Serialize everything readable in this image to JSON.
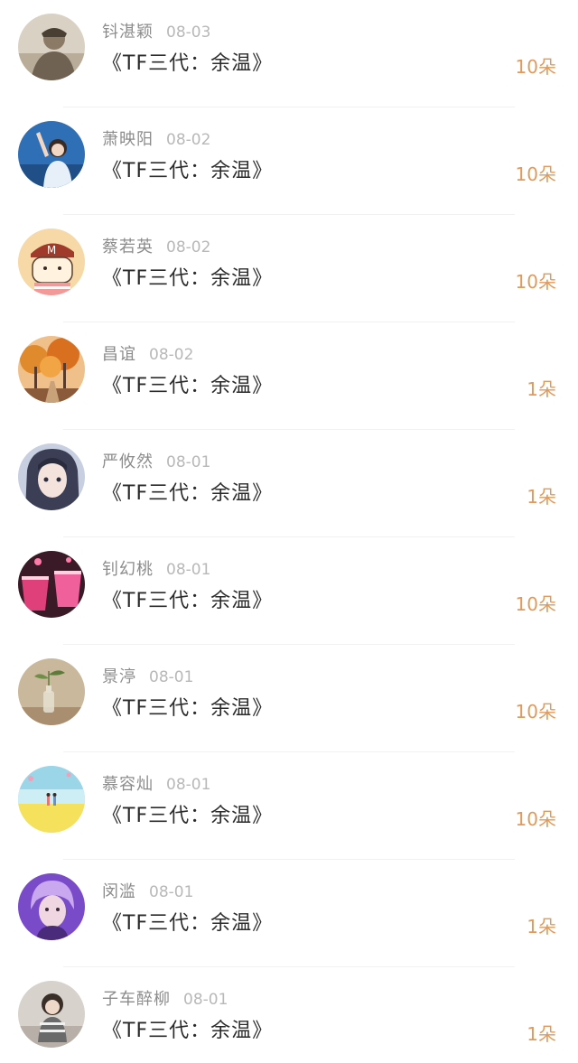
{
  "rows": [
    {
      "name": "钭湛颖",
      "date": "08-03",
      "title": "《TF三代：余温》",
      "amount": "10朵",
      "avatar_icon": "avatar-person-cap-icon",
      "avatar_colors": [
        "#8a7a66",
        "#d9d1c4"
      ]
    },
    {
      "name": "萧映阳",
      "date": "08-02",
      "title": "《TF三代：余温》",
      "amount": "10朵",
      "avatar_icon": "avatar-girl-sky-icon",
      "avatar_colors": [
        "#2f6fb5",
        "#e7f0f9"
      ]
    },
    {
      "name": "蔡若英",
      "date": "08-02",
      "title": "《TF三代：余温》",
      "amount": "10朵",
      "avatar_icon": "avatar-cartoon-boy-icon",
      "avatar_colors": [
        "#f6d9a7",
        "#a03a2b"
      ]
    },
    {
      "name": "昌谊",
      "date": "08-02",
      "title": "《TF三代：余温》",
      "amount": "1朵",
      "avatar_icon": "avatar-autumn-trees-icon",
      "avatar_colors": [
        "#e08a2e",
        "#8a5a3a"
      ]
    },
    {
      "name": "严攸然",
      "date": "08-01",
      "title": "《TF三代：余温》",
      "amount": "1朵",
      "avatar_icon": "avatar-anime-girl-icon",
      "avatar_colors": [
        "#3b3e55",
        "#c7cfe0"
      ]
    },
    {
      "name": "钊幻桃",
      "date": "08-01",
      "title": "《TF三代：余温》",
      "amount": "10朵",
      "avatar_icon": "avatar-drinks-icon",
      "avatar_colors": [
        "#e0407a",
        "#3a1a26"
      ]
    },
    {
      "name": "景渟",
      "date": "08-01",
      "title": "《TF三代：余温》",
      "amount": "10朵",
      "avatar_icon": "avatar-plant-bottle-icon",
      "avatar_colors": [
        "#a98f70",
        "#5f7b3c"
      ]
    },
    {
      "name": "慕容灿",
      "date": "08-01",
      "title": "《TF三代：余温》",
      "amount": "10朵",
      "avatar_icon": "avatar-beach-couple-icon",
      "avatar_colors": [
        "#9ad6e8",
        "#f5e15c"
      ]
    },
    {
      "name": "闵滥",
      "date": "08-01",
      "title": "《TF三代：余温》",
      "amount": "1朵",
      "avatar_icon": "avatar-purple-hair-icon",
      "avatar_colors": [
        "#7a4bc9",
        "#f0d6e0"
      ]
    },
    {
      "name": "子车醉柳",
      "date": "08-01",
      "title": "《TF三代：余温》",
      "amount": "1朵",
      "avatar_icon": "avatar-child-icon",
      "avatar_colors": [
        "#6a6a6a",
        "#d8d2cc"
      ]
    }
  ]
}
